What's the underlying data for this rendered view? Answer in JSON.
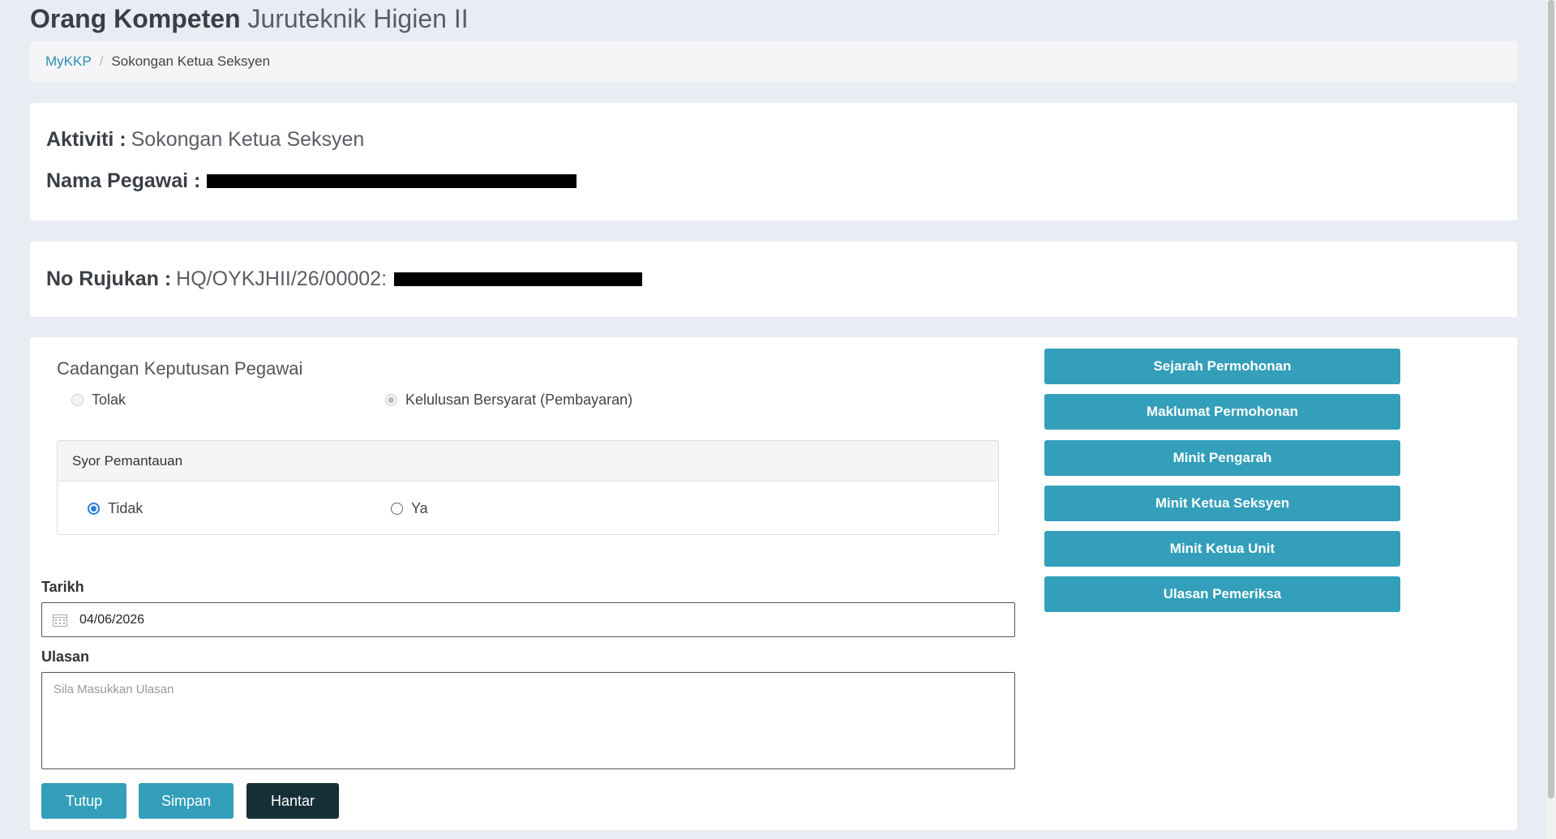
{
  "page": {
    "title_bold": "Orang Kompeten",
    "title_light": "Juruteknik Higien II"
  },
  "breadcrumb": {
    "home": "MyKKP",
    "separator": "/",
    "current": "Sokongan Ketua Seksyen"
  },
  "info": {
    "aktiviti_label": "Aktiviti :",
    "aktiviti_value": "Sokongan Ketua Seksyen",
    "nama_label": "Nama Pegawai :",
    "rujukan_label": "No Rujukan :",
    "rujukan_value": "HQ/OYKJHII/26/00002:"
  },
  "decision": {
    "label": "Cadangan Keputusan Pegawai",
    "options": [
      "Tolak",
      "Kelulusan Bersyarat (Pembayaran)"
    ],
    "selected": "Kelulusan Bersyarat (Pembayaran)"
  },
  "monitoring": {
    "heading": "Syor Pemantauan",
    "options": [
      "Tidak",
      "Ya"
    ],
    "selected": "Tidak"
  },
  "form": {
    "date_label": "Tarikh",
    "date_value": "04/06/2026",
    "remark_label": "Ulasan",
    "remark_placeholder": "Sila Masukkan Ulasan"
  },
  "actions": {
    "close": "Tutup",
    "save": "Simpan",
    "submit": "Hantar"
  },
  "side_buttons": [
    "Sejarah Permohonan",
    "Maklumat Permohonan",
    "Minit Pengarah",
    "Minit Ketua Seksyen",
    "Minit Ketua Unit",
    "Ulasan Pemeriksa"
  ],
  "colors": {
    "accent": "#339fba",
    "dark_button": "#162f37",
    "link": "#2b8fb8",
    "radio_checked": "#2b7fd6"
  }
}
